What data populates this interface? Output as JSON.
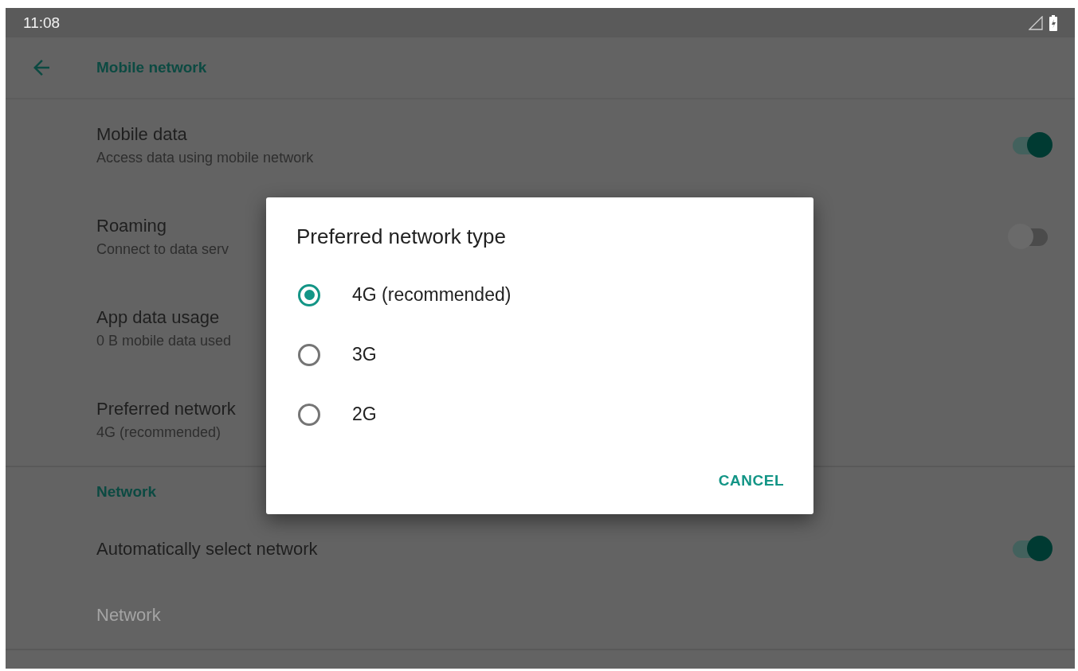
{
  "status_bar": {
    "time": "11:08"
  },
  "app_bar": {
    "title": "Mobile network"
  },
  "settings": [
    {
      "kind": "switch",
      "title": "Mobile data",
      "summary": "Access data using mobile network",
      "on": true
    },
    {
      "kind": "switch",
      "title": "Roaming",
      "summary": "Connect to data serv",
      "on": false
    },
    {
      "kind": "plain",
      "title": "App data usage",
      "summary": "0 B mobile data used"
    },
    {
      "kind": "plain",
      "title": "Preferred network",
      "summary": "4G (recommended)"
    }
  ],
  "network_section": {
    "header": "Network",
    "items": [
      {
        "kind": "switch",
        "title": "Automatically select network",
        "on": true,
        "disabled": false
      },
      {
        "kind": "plain",
        "title": "Network",
        "disabled": true
      }
    ]
  },
  "dialog": {
    "title": "Preferred network type",
    "options": [
      {
        "label": "4G (recommended)",
        "selected": true
      },
      {
        "label": "3G",
        "selected": false
      },
      {
        "label": "2G",
        "selected": false
      }
    ],
    "button": "CANCEL"
  }
}
